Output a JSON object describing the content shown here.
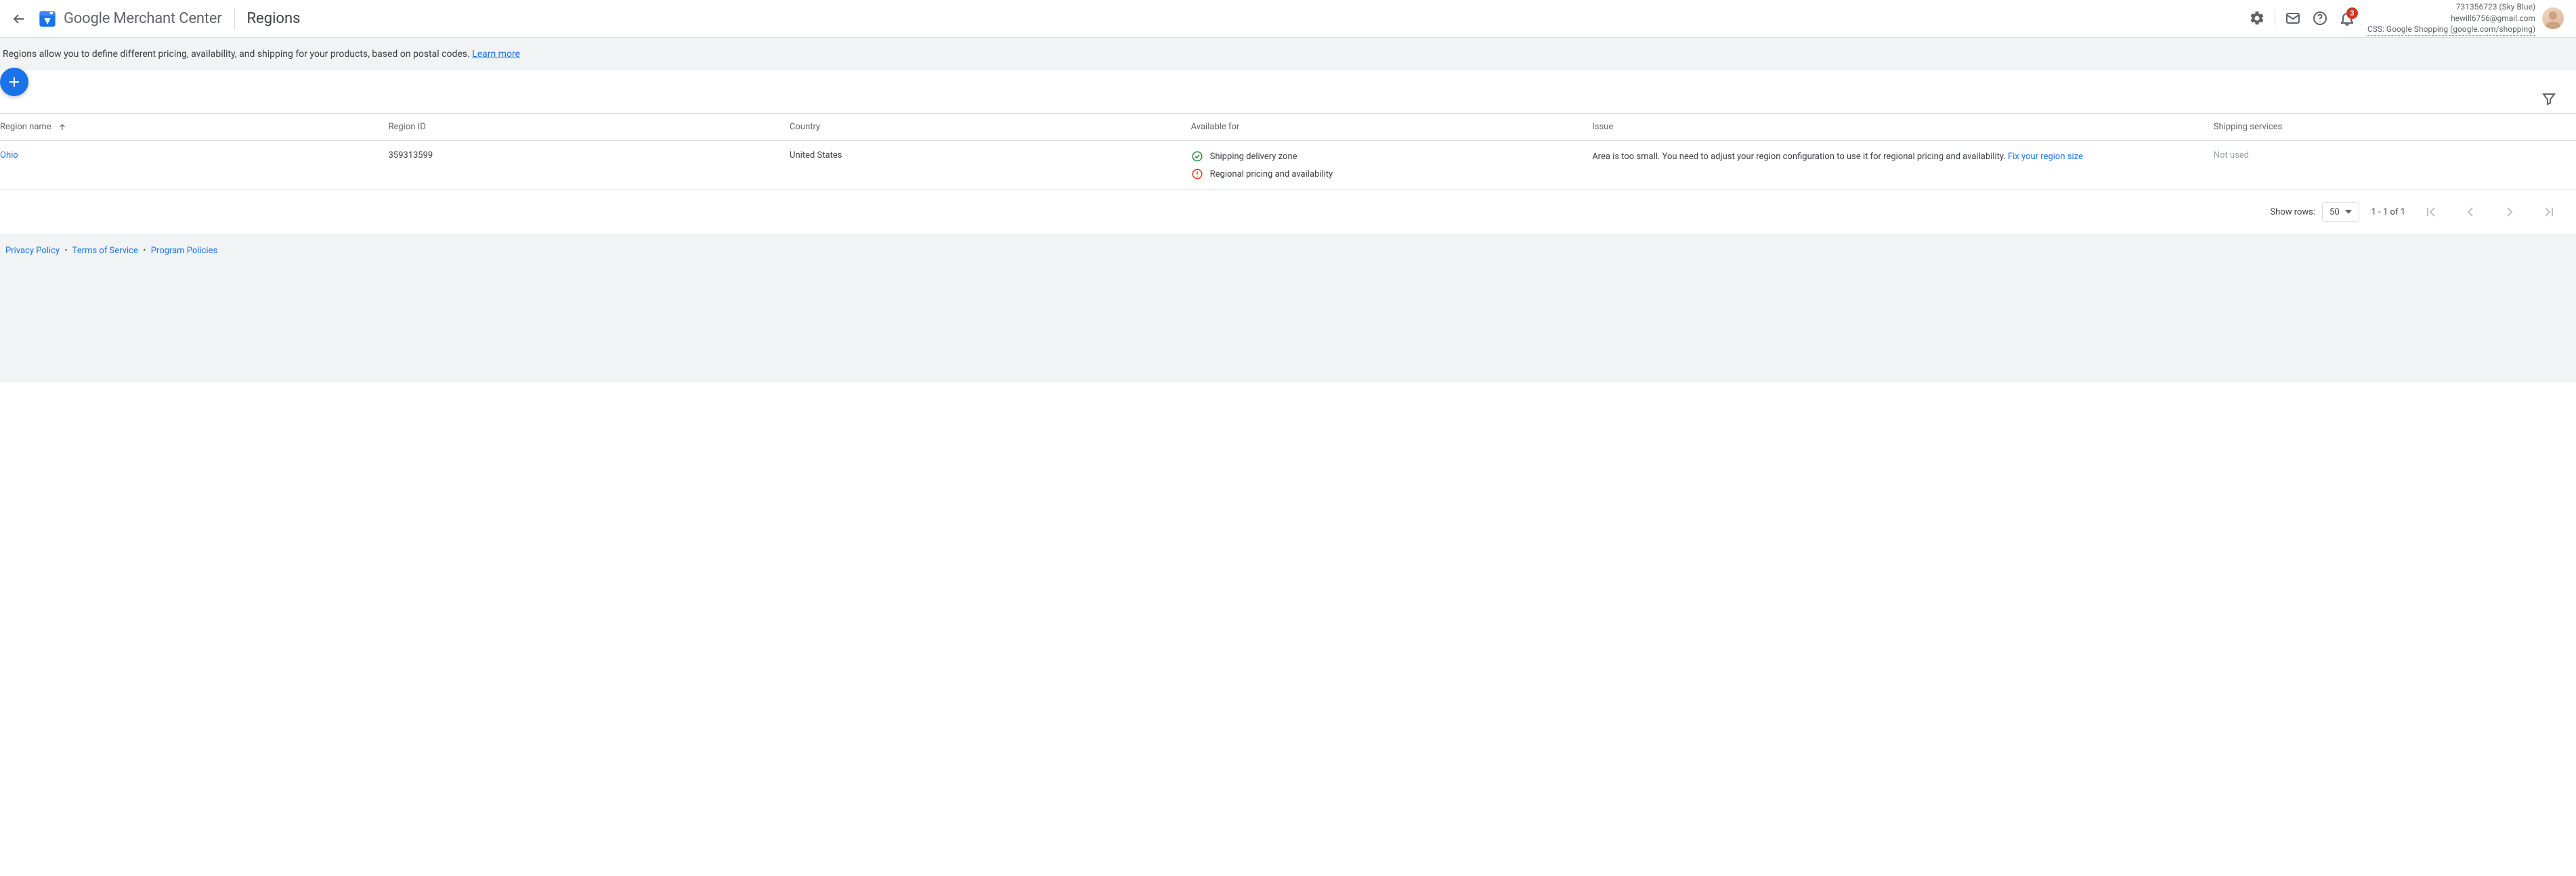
{
  "header": {
    "brand_prefix": "Google",
    "brand_suffix": " Merchant Center",
    "page_title": "Regions",
    "notifications_count": "3",
    "account": {
      "line1": "731356723 (Sky Blue)",
      "line2": "hewill6756@gmail.com",
      "line3": "CSS: Google Shopping (google.com/shopping)"
    }
  },
  "intro": {
    "text": "Regions allow you to define different pricing, availability, and shipping for your products, based on postal codes. ",
    "learn_more": "Learn more"
  },
  "table": {
    "headers": {
      "name": "Region name",
      "id": "Region ID",
      "country": "Country",
      "available_for": "Available for",
      "issue": "Issue",
      "shipping": "Shipping services"
    },
    "rows": [
      {
        "name": "Ohio",
        "id": "359313599",
        "country": "United States",
        "available": [
          {
            "status": "ok",
            "label": "Shipping delivery zone"
          },
          {
            "status": "error",
            "label": "Regional pricing and availability"
          }
        ],
        "issue_text": "Area is too small. You need to adjust your region configuration to use it for regional pricing and availability. ",
        "issue_link": "Fix your region size",
        "shipping": "Not used"
      }
    ]
  },
  "pagination": {
    "show_rows_label": "Show rows:",
    "rows_value": "50",
    "range": "1 - 1 of 1"
  },
  "footer": {
    "privacy": "Privacy Policy",
    "terms": "Terms of Service",
    "policies": "Program Policies"
  }
}
